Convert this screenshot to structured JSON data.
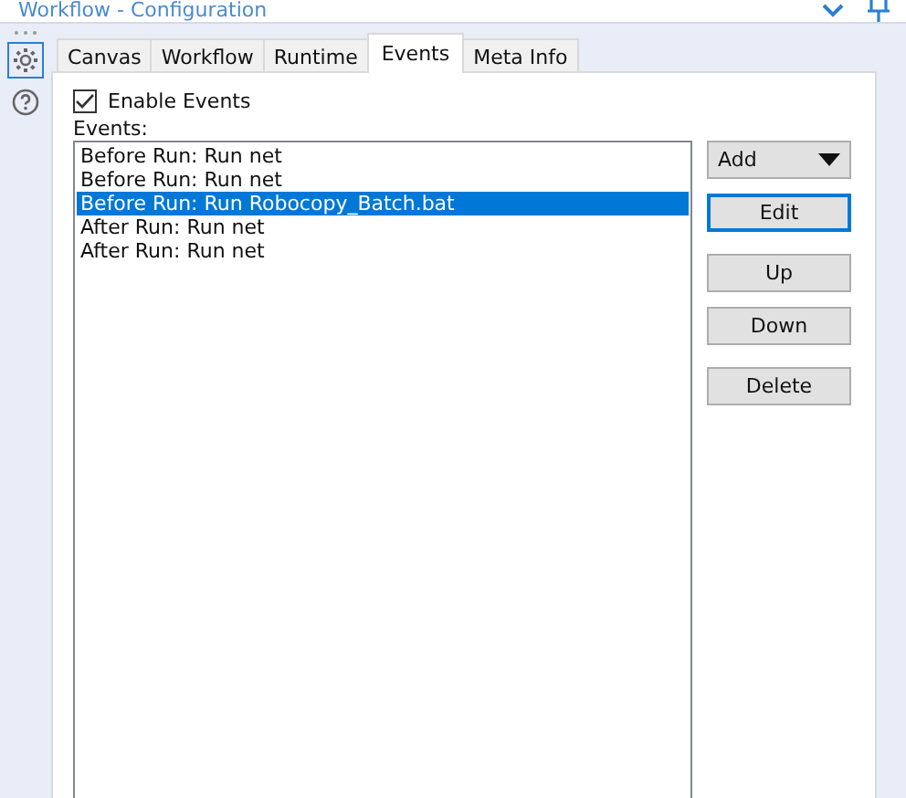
{
  "window": {
    "title": "Workflow - Configuration"
  },
  "sidebar": {
    "items": [
      {
        "kind": "settings",
        "selected": true
      },
      {
        "kind": "help",
        "selected": false
      }
    ]
  },
  "tabs": [
    {
      "label": "Canvas",
      "selected": false
    },
    {
      "label": "Workflow",
      "selected": false
    },
    {
      "label": "Runtime",
      "selected": false
    },
    {
      "label": "Events",
      "selected": true
    },
    {
      "label": "Meta Info",
      "selected": false
    }
  ],
  "enable_events": {
    "label": "Enable Events",
    "checked": true
  },
  "events": {
    "label": "Events:",
    "items": [
      {
        "text": "Before Run: Run net",
        "selected": false
      },
      {
        "text": "Before Run: Run net",
        "selected": false
      },
      {
        "text": "Before Run: Run Robocopy_Batch.bat",
        "selected": true
      },
      {
        "text": "After Run: Run net",
        "selected": false
      },
      {
        "text": "After Run: Run net",
        "selected": false
      }
    ]
  },
  "buttons": [
    {
      "label": "Add",
      "kind": "dropdown",
      "focused": false
    },
    {
      "label": "Edit",
      "kind": "plain",
      "focused": true
    },
    {
      "label": "Up",
      "kind": "plain",
      "focused": false
    },
    {
      "label": "Down",
      "kind": "plain",
      "focused": false
    },
    {
      "label": "Delete",
      "kind": "plain",
      "focused": false
    }
  ]
}
